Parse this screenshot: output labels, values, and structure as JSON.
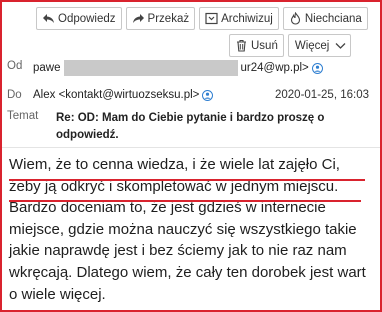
{
  "toolbar": {
    "reply_label": "Odpowiedz",
    "forward_label": "Przekaż",
    "archive_label": "Archiwizuj",
    "junk_label": "Niechciana",
    "delete_label": "Usuń",
    "more_label": "Więcej"
  },
  "header": {
    "from_label": "Od",
    "from_name_visible": "pawe",
    "from_email_visible": "ur24@wp.pl>",
    "to_label": "Do",
    "to_value": "Alex <kontakt@wirtuozseksu.pl>",
    "date": "2020-01-25, 16:03",
    "subject_label": "Temat",
    "subject": "Re: OD: Mam do Ciebie pytanie i bardzo proszę o odpowiedź."
  },
  "body": {
    "text": "Wiem, że to cenna wiedza, i że wiele lat zajęło Ci, żeby ją odkryć i skompletować w jednym miejscu. Bardzo doceniam to, że jest gdzieś w internecie miejsce, gdzie można nauczyć się wszystkiego takie jakie naprawdę jest i bez ściemy jak to nie raz nam wkręcają. Dlatego wiem, że cały ten dorobek jest wart o wiele więcej."
  },
  "colors": {
    "highlight": "#d9232e",
    "contact_icon": "#2f7fd1"
  }
}
